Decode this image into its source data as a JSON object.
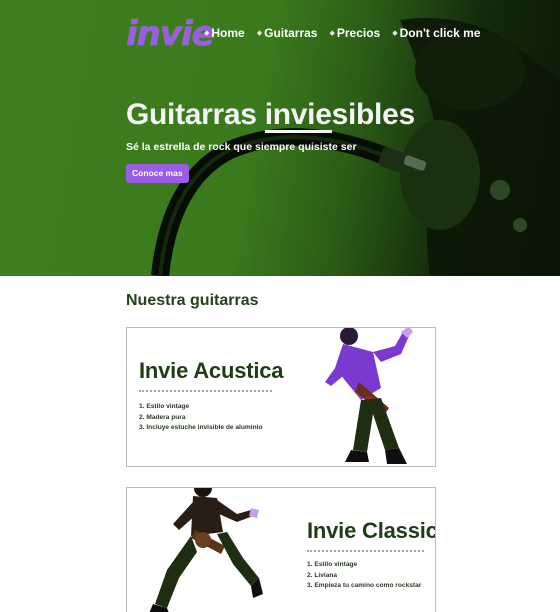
{
  "header": {
    "logo_text": "invie",
    "nav": [
      {
        "label": "Home"
      },
      {
        "label": "Guitarras"
      },
      {
        "label": "Precios"
      },
      {
        "label": "Don't click me"
      }
    ]
  },
  "hero": {
    "title_start": "Guitarras ",
    "title_underlined": "invie",
    "title_end": "sibles",
    "subtitle": "Sé la estrella de rock que siempre quisiste ser",
    "cta_label": "Conoce mas"
  },
  "products": {
    "heading": "Nuestra guitarras",
    "items": [
      {
        "name": "Invie Acustica",
        "features": [
          "1. Estilo vintage",
          "2. Madera pura",
          "3. Incluye estuche invisible de aluminio"
        ]
      },
      {
        "name": "Invie Classic",
        "features": [
          "1. Estilo vintage",
          "2. Liviana",
          "3. Empieza tu camino como rockstar"
        ]
      }
    ]
  },
  "colors": {
    "brand_purple": "#9b5de5",
    "hero_green": "#3b7a1c",
    "heading_green": "#24431c"
  }
}
